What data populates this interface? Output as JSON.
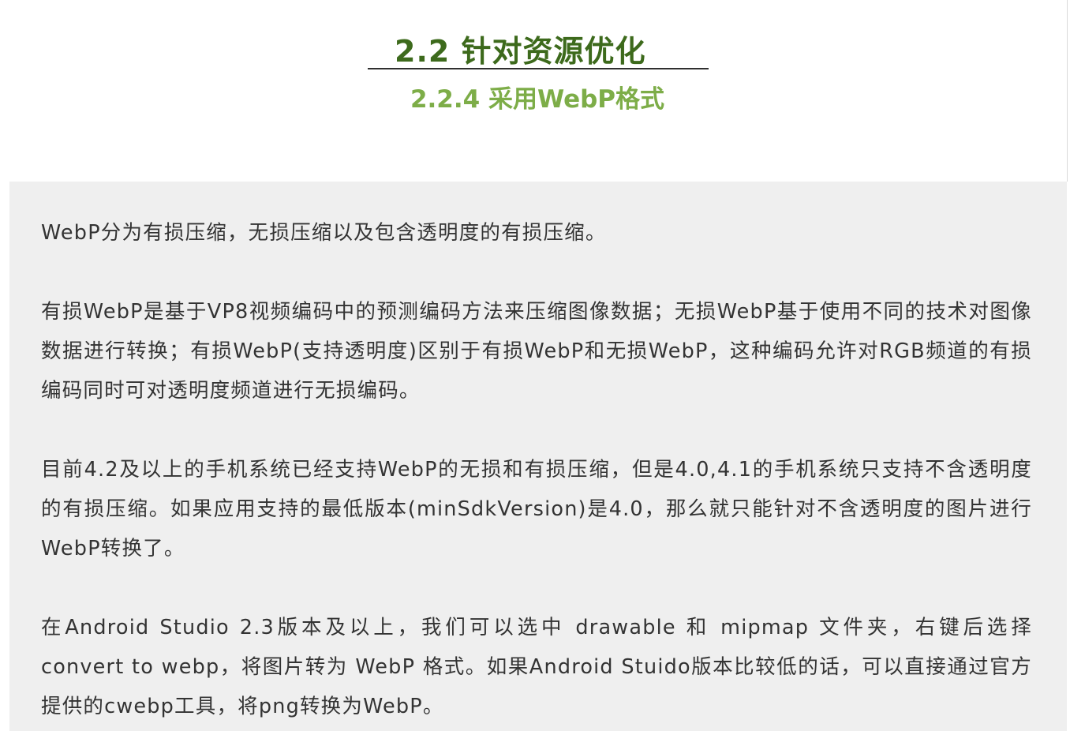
{
  "header": {
    "section_title": "2.2 针对资源优化",
    "sub_title": "2.2.4 采用WebP格式"
  },
  "content": {
    "paragraphs": [
      "WebP分为有损压缩，无损压缩以及包含透明度的有损压缩。",
      "有损WebP是基于VP8视频编码中的预测编码方法来压缩图像数据；无损WebP基于使用不同的技术对图像数据进行转换；有损WebP(支持透明度)区别于有损WebP和无损WebP，这种编码允许对RGB频道的有损编码同时可对透明度频道进行无损编码。",
      "目前4.2及以上的手机系统已经支持WebP的无损和有损压缩，但是4.0,4.1的手机系统只支持不含透明度的有损压缩。如果应用支持的最低版本(minSdkVersion)是4.0，那么就只能针对不含透明度的图片进行WebP转换了。",
      "在Android Studio 2.3版本及以上，我们可以选中 drawable 和 mipmap 文件夹，右键后选择 convert to webp，将图片转为 WebP 格式。如果Android Stuido版本比较低的话，可以直接通过官方提供的cwebp工具，将png转换为WebP。"
    ]
  },
  "colors": {
    "section_title": "#3d6a1c",
    "sub_title": "#7dad48",
    "content_background": "#efefef",
    "body_text": "#333333"
  }
}
